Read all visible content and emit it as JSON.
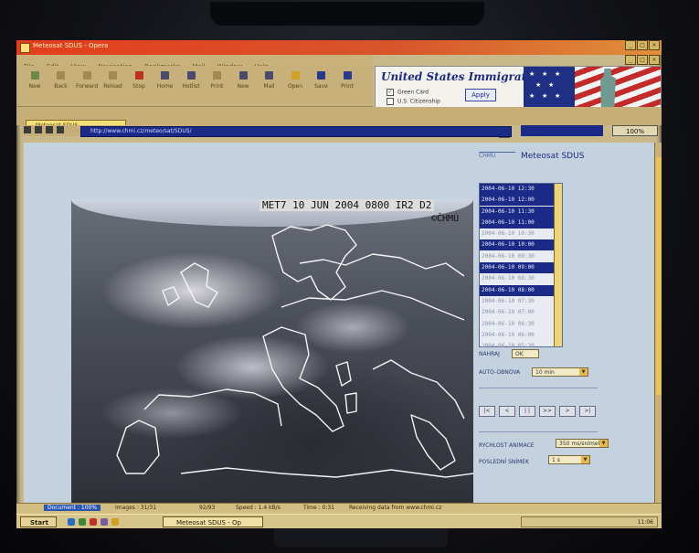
{
  "window": {
    "title": "Meteosat SDUS - Opera",
    "buttons": [
      "_",
      "□",
      "×"
    ]
  },
  "menu": [
    "File",
    "Edit",
    "View",
    "Navigation",
    "Bookmarks",
    "Mail",
    "Window",
    "Help"
  ],
  "toolbar": [
    {
      "label": "New",
      "icon": "new-page-icon",
      "color": "#6a8a4a"
    },
    {
      "label": "Back",
      "icon": "back-arrow-icon",
      "color": "#a08a50"
    },
    {
      "label": "Forward",
      "icon": "forward-arrow-icon",
      "color": "#a08a50"
    },
    {
      "label": "Reload",
      "icon": "reload-icon",
      "color": "#a08a50"
    },
    {
      "label": "Stop",
      "icon": "stop-icon",
      "color": "#c03020"
    },
    {
      "label": "Home",
      "icon": "home-icon",
      "color": "#4a4a6a"
    },
    {
      "label": "Hotlist",
      "icon": "hotlist-icon",
      "color": "#4a4a6a"
    },
    {
      "label": "Print",
      "icon": "print-icon",
      "color": "#a08a50"
    },
    {
      "label": "New",
      "icon": "new-window-icon",
      "color": "#4a4a6a"
    },
    {
      "label": "Mail",
      "icon": "mail-icon",
      "color": "#4a4a6a"
    },
    {
      "label": "Open",
      "icon": "open-folder-icon",
      "color": "#d0a020"
    },
    {
      "label": "Save",
      "icon": "save-icon",
      "color": "#2a3a8a"
    },
    {
      "label": "Print",
      "icon": "printer-icon",
      "color": "#2a3a8a"
    }
  ],
  "ad": {
    "title": "United States Immigration",
    "option1": "Green Card",
    "option2": "U.S. Citizenship",
    "apply": "Apply"
  },
  "tab_label": "Meteosat SDUS",
  "address": {
    "url": "http://www.chmi.cz/meteo/sat/SDUS/"
  },
  "zoom": "100%",
  "satellite": {
    "label": "MET7 10 JUN 2004 0800 IR2 D2",
    "credit": "©ČHMÚ"
  },
  "panel": {
    "logo": "ČHMÚ",
    "title": "Meteosat SDUS",
    "times": [
      {
        "t": "2004-06-10   12:30",
        "state": "sel"
      },
      {
        "t": "2004-06-10   12:00",
        "state": "sel"
      },
      {
        "t": "2004-06-10   11:30",
        "state": "sel"
      },
      {
        "t": "2004-06-10   11:00",
        "state": "sel"
      },
      {
        "t": "2004-06-10   10:30",
        "state": "un"
      },
      {
        "t": "2004-06-10   10:00",
        "state": "sel"
      },
      {
        "t": "2004-06-10   09:30",
        "state": "un"
      },
      {
        "t": "2004-06-10   09:00",
        "state": "sel"
      },
      {
        "t": "2004-06-10   08:30",
        "state": "un"
      },
      {
        "t": "2004-06-10   08:00",
        "state": "sel"
      },
      {
        "t": "2004-06-10   07:30",
        "state": "un"
      },
      {
        "t": "2004-06-10   07:00",
        "state": "un"
      },
      {
        "t": "2004-06-10   06:30",
        "state": "un"
      },
      {
        "t": "2004-06-10   06:00",
        "state": "un"
      },
      {
        "t": "2004-06-10   05:30",
        "state": "un"
      }
    ],
    "nahraj_label": "NAHRAJ",
    "nahraj_btn": "OK",
    "autoobnova_label": "AUTO-OBNOVA",
    "autoobnova_value": "10 min",
    "controls": [
      "|<",
      "<",
      "| |",
      ">>",
      ">",
      ">|"
    ],
    "rychlost_label": "RYCHLOST ANIMACE",
    "rychlost_value": "350 ms/snímek",
    "posledni_label": "POSLEDNÍ SNÍMEK",
    "posledni_value": "1 s"
  },
  "status": {
    "document": "Document : 100%",
    "images": "Images : 31/31",
    "size": "92/93",
    "speed": "Speed : 1.4 kB/s",
    "time": "Time : 0:31",
    "message": "Receiving data from www.chmi.cz"
  },
  "taskbar": {
    "start": "Start",
    "task": "Meteosat SDUS - Op",
    "clock": "11:06"
  }
}
